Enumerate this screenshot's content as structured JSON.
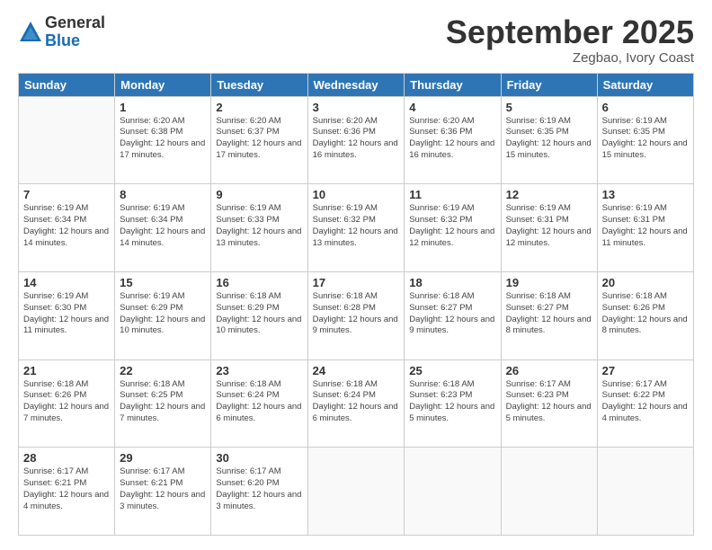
{
  "logo": {
    "general": "General",
    "blue": "Blue"
  },
  "header": {
    "month": "September 2025",
    "location": "Zegbao, Ivory Coast"
  },
  "days_of_week": [
    "Sunday",
    "Monday",
    "Tuesday",
    "Wednesday",
    "Thursday",
    "Friday",
    "Saturday"
  ],
  "weeks": [
    [
      {
        "day": "",
        "sunrise": "",
        "sunset": "",
        "daylight": ""
      },
      {
        "day": "1",
        "sunrise": "Sunrise: 6:20 AM",
        "sunset": "Sunset: 6:38 PM",
        "daylight": "Daylight: 12 hours and 17 minutes."
      },
      {
        "day": "2",
        "sunrise": "Sunrise: 6:20 AM",
        "sunset": "Sunset: 6:37 PM",
        "daylight": "Daylight: 12 hours and 17 minutes."
      },
      {
        "day": "3",
        "sunrise": "Sunrise: 6:20 AM",
        "sunset": "Sunset: 6:36 PM",
        "daylight": "Daylight: 12 hours and 16 minutes."
      },
      {
        "day": "4",
        "sunrise": "Sunrise: 6:20 AM",
        "sunset": "Sunset: 6:36 PM",
        "daylight": "Daylight: 12 hours and 16 minutes."
      },
      {
        "day": "5",
        "sunrise": "Sunrise: 6:19 AM",
        "sunset": "Sunset: 6:35 PM",
        "daylight": "Daylight: 12 hours and 15 minutes."
      },
      {
        "day": "6",
        "sunrise": "Sunrise: 6:19 AM",
        "sunset": "Sunset: 6:35 PM",
        "daylight": "Daylight: 12 hours and 15 minutes."
      }
    ],
    [
      {
        "day": "7",
        "sunrise": "Sunrise: 6:19 AM",
        "sunset": "Sunset: 6:34 PM",
        "daylight": "Daylight: 12 hours and 14 minutes."
      },
      {
        "day": "8",
        "sunrise": "Sunrise: 6:19 AM",
        "sunset": "Sunset: 6:34 PM",
        "daylight": "Daylight: 12 hours and 14 minutes."
      },
      {
        "day": "9",
        "sunrise": "Sunrise: 6:19 AM",
        "sunset": "Sunset: 6:33 PM",
        "daylight": "Daylight: 12 hours and 13 minutes."
      },
      {
        "day": "10",
        "sunrise": "Sunrise: 6:19 AM",
        "sunset": "Sunset: 6:32 PM",
        "daylight": "Daylight: 12 hours and 13 minutes."
      },
      {
        "day": "11",
        "sunrise": "Sunrise: 6:19 AM",
        "sunset": "Sunset: 6:32 PM",
        "daylight": "Daylight: 12 hours and 12 minutes."
      },
      {
        "day": "12",
        "sunrise": "Sunrise: 6:19 AM",
        "sunset": "Sunset: 6:31 PM",
        "daylight": "Daylight: 12 hours and 12 minutes."
      },
      {
        "day": "13",
        "sunrise": "Sunrise: 6:19 AM",
        "sunset": "Sunset: 6:31 PM",
        "daylight": "Daylight: 12 hours and 11 minutes."
      }
    ],
    [
      {
        "day": "14",
        "sunrise": "Sunrise: 6:19 AM",
        "sunset": "Sunset: 6:30 PM",
        "daylight": "Daylight: 12 hours and 11 minutes."
      },
      {
        "day": "15",
        "sunrise": "Sunrise: 6:19 AM",
        "sunset": "Sunset: 6:29 PM",
        "daylight": "Daylight: 12 hours and 10 minutes."
      },
      {
        "day": "16",
        "sunrise": "Sunrise: 6:18 AM",
        "sunset": "Sunset: 6:29 PM",
        "daylight": "Daylight: 12 hours and 10 minutes."
      },
      {
        "day": "17",
        "sunrise": "Sunrise: 6:18 AM",
        "sunset": "Sunset: 6:28 PM",
        "daylight": "Daylight: 12 hours and 9 minutes."
      },
      {
        "day": "18",
        "sunrise": "Sunrise: 6:18 AM",
        "sunset": "Sunset: 6:27 PM",
        "daylight": "Daylight: 12 hours and 9 minutes."
      },
      {
        "day": "19",
        "sunrise": "Sunrise: 6:18 AM",
        "sunset": "Sunset: 6:27 PM",
        "daylight": "Daylight: 12 hours and 8 minutes."
      },
      {
        "day": "20",
        "sunrise": "Sunrise: 6:18 AM",
        "sunset": "Sunset: 6:26 PM",
        "daylight": "Daylight: 12 hours and 8 minutes."
      }
    ],
    [
      {
        "day": "21",
        "sunrise": "Sunrise: 6:18 AM",
        "sunset": "Sunset: 6:26 PM",
        "daylight": "Daylight: 12 hours and 7 minutes."
      },
      {
        "day": "22",
        "sunrise": "Sunrise: 6:18 AM",
        "sunset": "Sunset: 6:25 PM",
        "daylight": "Daylight: 12 hours and 7 minutes."
      },
      {
        "day": "23",
        "sunrise": "Sunrise: 6:18 AM",
        "sunset": "Sunset: 6:24 PM",
        "daylight": "Daylight: 12 hours and 6 minutes."
      },
      {
        "day": "24",
        "sunrise": "Sunrise: 6:18 AM",
        "sunset": "Sunset: 6:24 PM",
        "daylight": "Daylight: 12 hours and 6 minutes."
      },
      {
        "day": "25",
        "sunrise": "Sunrise: 6:18 AM",
        "sunset": "Sunset: 6:23 PM",
        "daylight": "Daylight: 12 hours and 5 minutes."
      },
      {
        "day": "26",
        "sunrise": "Sunrise: 6:17 AM",
        "sunset": "Sunset: 6:23 PM",
        "daylight": "Daylight: 12 hours and 5 minutes."
      },
      {
        "day": "27",
        "sunrise": "Sunrise: 6:17 AM",
        "sunset": "Sunset: 6:22 PM",
        "daylight": "Daylight: 12 hours and 4 minutes."
      }
    ],
    [
      {
        "day": "28",
        "sunrise": "Sunrise: 6:17 AM",
        "sunset": "Sunset: 6:21 PM",
        "daylight": "Daylight: 12 hours and 4 minutes."
      },
      {
        "day": "29",
        "sunrise": "Sunrise: 6:17 AM",
        "sunset": "Sunset: 6:21 PM",
        "daylight": "Daylight: 12 hours and 3 minutes."
      },
      {
        "day": "30",
        "sunrise": "Sunrise: 6:17 AM",
        "sunset": "Sunset: 6:20 PM",
        "daylight": "Daylight: 12 hours and 3 minutes."
      },
      {
        "day": "",
        "sunrise": "",
        "sunset": "",
        "daylight": ""
      },
      {
        "day": "",
        "sunrise": "",
        "sunset": "",
        "daylight": ""
      },
      {
        "day": "",
        "sunrise": "",
        "sunset": "",
        "daylight": ""
      },
      {
        "day": "",
        "sunrise": "",
        "sunset": "",
        "daylight": ""
      }
    ]
  ]
}
